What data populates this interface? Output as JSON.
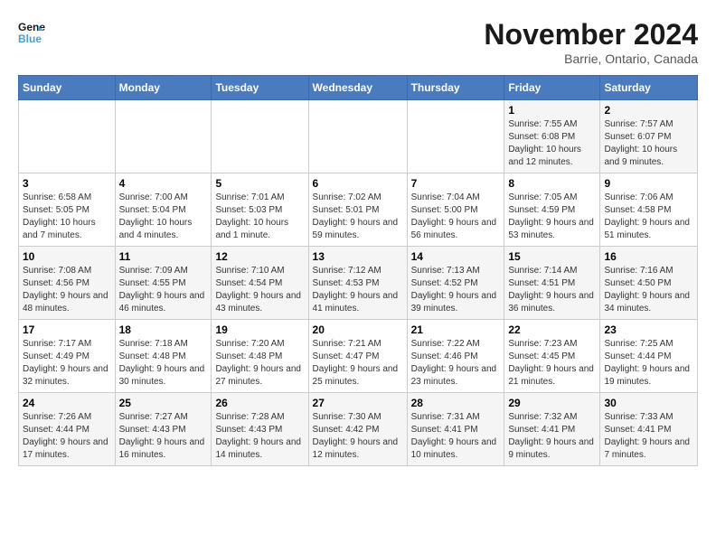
{
  "header": {
    "logo_line1": "General",
    "logo_line2": "Blue",
    "month": "November 2024",
    "location": "Barrie, Ontario, Canada"
  },
  "weekdays": [
    "Sunday",
    "Monday",
    "Tuesday",
    "Wednesday",
    "Thursday",
    "Friday",
    "Saturday"
  ],
  "weeks": [
    [
      {
        "day": "",
        "info": ""
      },
      {
        "day": "",
        "info": ""
      },
      {
        "day": "",
        "info": ""
      },
      {
        "day": "",
        "info": ""
      },
      {
        "day": "",
        "info": ""
      },
      {
        "day": "1",
        "info": "Sunrise: 7:55 AM\nSunset: 6:08 PM\nDaylight: 10 hours and 12 minutes."
      },
      {
        "day": "2",
        "info": "Sunrise: 7:57 AM\nSunset: 6:07 PM\nDaylight: 10 hours and 9 minutes."
      }
    ],
    [
      {
        "day": "3",
        "info": "Sunrise: 6:58 AM\nSunset: 5:05 PM\nDaylight: 10 hours and 7 minutes."
      },
      {
        "day": "4",
        "info": "Sunrise: 7:00 AM\nSunset: 5:04 PM\nDaylight: 10 hours and 4 minutes."
      },
      {
        "day": "5",
        "info": "Sunrise: 7:01 AM\nSunset: 5:03 PM\nDaylight: 10 hours and 1 minute."
      },
      {
        "day": "6",
        "info": "Sunrise: 7:02 AM\nSunset: 5:01 PM\nDaylight: 9 hours and 59 minutes."
      },
      {
        "day": "7",
        "info": "Sunrise: 7:04 AM\nSunset: 5:00 PM\nDaylight: 9 hours and 56 minutes."
      },
      {
        "day": "8",
        "info": "Sunrise: 7:05 AM\nSunset: 4:59 PM\nDaylight: 9 hours and 53 minutes."
      },
      {
        "day": "9",
        "info": "Sunrise: 7:06 AM\nSunset: 4:58 PM\nDaylight: 9 hours and 51 minutes."
      }
    ],
    [
      {
        "day": "10",
        "info": "Sunrise: 7:08 AM\nSunset: 4:56 PM\nDaylight: 9 hours and 48 minutes."
      },
      {
        "day": "11",
        "info": "Sunrise: 7:09 AM\nSunset: 4:55 PM\nDaylight: 9 hours and 46 minutes."
      },
      {
        "day": "12",
        "info": "Sunrise: 7:10 AM\nSunset: 4:54 PM\nDaylight: 9 hours and 43 minutes."
      },
      {
        "day": "13",
        "info": "Sunrise: 7:12 AM\nSunset: 4:53 PM\nDaylight: 9 hours and 41 minutes."
      },
      {
        "day": "14",
        "info": "Sunrise: 7:13 AM\nSunset: 4:52 PM\nDaylight: 9 hours and 39 minutes."
      },
      {
        "day": "15",
        "info": "Sunrise: 7:14 AM\nSunset: 4:51 PM\nDaylight: 9 hours and 36 minutes."
      },
      {
        "day": "16",
        "info": "Sunrise: 7:16 AM\nSunset: 4:50 PM\nDaylight: 9 hours and 34 minutes."
      }
    ],
    [
      {
        "day": "17",
        "info": "Sunrise: 7:17 AM\nSunset: 4:49 PM\nDaylight: 9 hours and 32 minutes."
      },
      {
        "day": "18",
        "info": "Sunrise: 7:18 AM\nSunset: 4:48 PM\nDaylight: 9 hours and 30 minutes."
      },
      {
        "day": "19",
        "info": "Sunrise: 7:20 AM\nSunset: 4:48 PM\nDaylight: 9 hours and 27 minutes."
      },
      {
        "day": "20",
        "info": "Sunrise: 7:21 AM\nSunset: 4:47 PM\nDaylight: 9 hours and 25 minutes."
      },
      {
        "day": "21",
        "info": "Sunrise: 7:22 AM\nSunset: 4:46 PM\nDaylight: 9 hours and 23 minutes."
      },
      {
        "day": "22",
        "info": "Sunrise: 7:23 AM\nSunset: 4:45 PM\nDaylight: 9 hours and 21 minutes."
      },
      {
        "day": "23",
        "info": "Sunrise: 7:25 AM\nSunset: 4:44 PM\nDaylight: 9 hours and 19 minutes."
      }
    ],
    [
      {
        "day": "24",
        "info": "Sunrise: 7:26 AM\nSunset: 4:44 PM\nDaylight: 9 hours and 17 minutes."
      },
      {
        "day": "25",
        "info": "Sunrise: 7:27 AM\nSunset: 4:43 PM\nDaylight: 9 hours and 16 minutes."
      },
      {
        "day": "26",
        "info": "Sunrise: 7:28 AM\nSunset: 4:43 PM\nDaylight: 9 hours and 14 minutes."
      },
      {
        "day": "27",
        "info": "Sunrise: 7:30 AM\nSunset: 4:42 PM\nDaylight: 9 hours and 12 minutes."
      },
      {
        "day": "28",
        "info": "Sunrise: 7:31 AM\nSunset: 4:41 PM\nDaylight: 9 hours and 10 minutes."
      },
      {
        "day": "29",
        "info": "Sunrise: 7:32 AM\nSunset: 4:41 PM\nDaylight: 9 hours and 9 minutes."
      },
      {
        "day": "30",
        "info": "Sunrise: 7:33 AM\nSunset: 4:41 PM\nDaylight: 9 hours and 7 minutes."
      }
    ]
  ]
}
